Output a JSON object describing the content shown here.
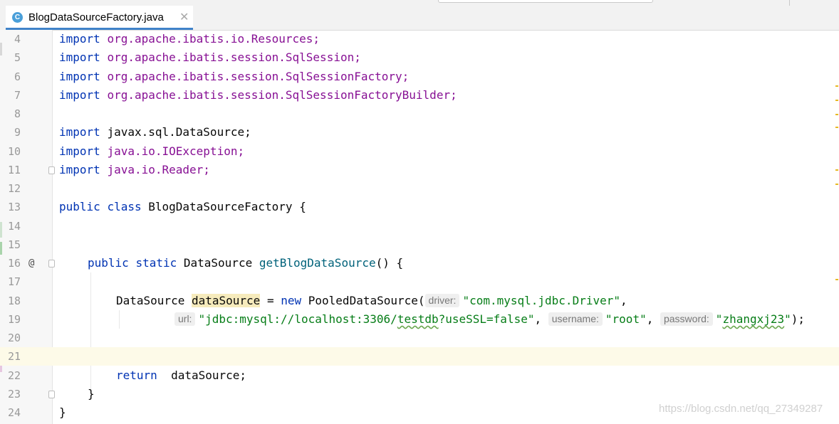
{
  "tab": {
    "title": "BlogDataSourceFactory.java",
    "icon": "java-class-icon",
    "icon_letter": "C",
    "close_glyph": "✕"
  },
  "gutter": {
    "override_marker": "@"
  },
  "code": {
    "l4": {
      "num": "4",
      "kw": "import",
      "rest": "org.apache.ibatis.io.Resources;"
    },
    "l5": {
      "num": "5",
      "kw": "import",
      "rest": "org.apache.ibatis.session.SqlSession;"
    },
    "l6": {
      "num": "6",
      "kw": "import",
      "rest": "org.apache.ibatis.session.SqlSessionFactory;"
    },
    "l7": {
      "num": "7",
      "kw": "import",
      "rest": "org.apache.ibatis.session.SqlSessionFactoryBuilder;"
    },
    "l8": {
      "num": "8"
    },
    "l9": {
      "num": "9",
      "kw": "import",
      "rest": "javax.sql.DataSource;"
    },
    "l10": {
      "num": "10",
      "kw": "import",
      "rest": "java.io.IOException;"
    },
    "l11": {
      "num": "11",
      "kw": "import",
      "rest": "java.io.Reader;"
    },
    "l12": {
      "num": "12"
    },
    "l13": {
      "num": "13",
      "kw1": "public",
      "kw2": "class",
      "name": "BlogDataSourceFactory",
      "brace": "{"
    },
    "l14": {
      "num": "14"
    },
    "l15": {
      "num": "15"
    },
    "l16": {
      "num": "16",
      "kw1": "public",
      "kw2": "static",
      "type": "DataSource",
      "method": "getBlogDataSource",
      "tail": "() {"
    },
    "l17": {
      "num": "17"
    },
    "l18": {
      "num": "18",
      "type": "DataSource",
      "var": "dataSource",
      "op": "=",
      "kw": "new",
      "ctor": "PooledDataSource(",
      "hint_driver": "driver:",
      "driver": "\"com.mysql.jdbc.Driver\"",
      "comma": ","
    },
    "l19": {
      "num": "19",
      "hint_url": "url:",
      "url_pre": "\"jdbc:mysql://localhost:3306/",
      "url_db": "testdb",
      "url_post": "?useSSL=false\"",
      "comma1": ",",
      "hint_username": "username:",
      "username": "\"root\"",
      "comma2": ",",
      "hint_password": "password:",
      "pw_open": "\"",
      "pw_val": "zhangxj23",
      "pw_close": "\"",
      "end": ");"
    },
    "l20": {
      "num": "20"
    },
    "l21": {
      "num": "21"
    },
    "l22": {
      "num": "22",
      "kw": "return",
      "var": "dataSource;"
    },
    "l23": {
      "num": "23",
      "brace": "}"
    },
    "l24": {
      "num": "24",
      "brace": "}"
    }
  },
  "watermark": "https://blog.csdn.net/qq_27349287",
  "colors": {
    "keyword": "#0033b3",
    "package": "#871094",
    "string": "#067d17",
    "method": "#00627a",
    "current_line": "#fdfae8",
    "highlight": "#f6ebbc"
  }
}
